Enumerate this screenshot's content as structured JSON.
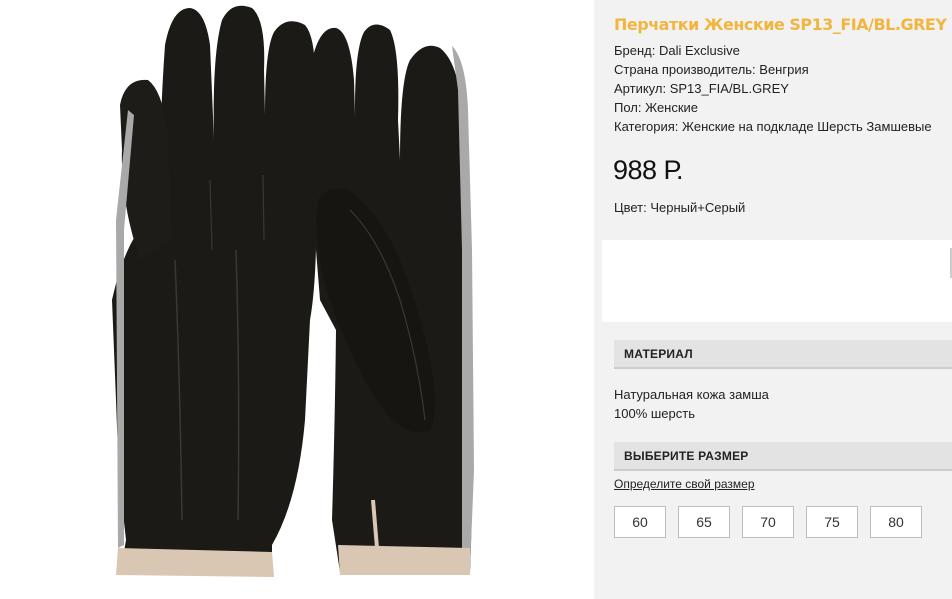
{
  "product": {
    "title": "Перчатки Женские SP13_FIA/BL.GREY",
    "image_icon": "gloves-photo",
    "specs": [
      "Бренд: Dali Exclusive",
      "Страна производитель: Венгрия",
      "Артикул: SP13_FIA/BL.GREY",
      "Пол: Женские",
      "Категория: Женские на подкладе Шерсть Замшевые"
    ],
    "price": "988 Р.",
    "color": "Цвет: Черный+Серый"
  },
  "material": {
    "header": "МАТЕРИАЛ",
    "lines": [
      "Натуральная кожа замша",
      "100% шерсть"
    ]
  },
  "size": {
    "header": "ВЫБЕРИТЕ РАЗМЕР",
    "guide_link": "Определите свой размер",
    "options": [
      "60",
      "65",
      "70",
      "75",
      "80"
    ]
  },
  "colors": {
    "title": "#f2b640",
    "panel_bg": "#f2f2f2",
    "section_bg": "#e3e3e3",
    "glove": "#1b1a17",
    "trim_grey": "#a9a9a9",
    "cuff_beige": "#d9c6b3"
  }
}
